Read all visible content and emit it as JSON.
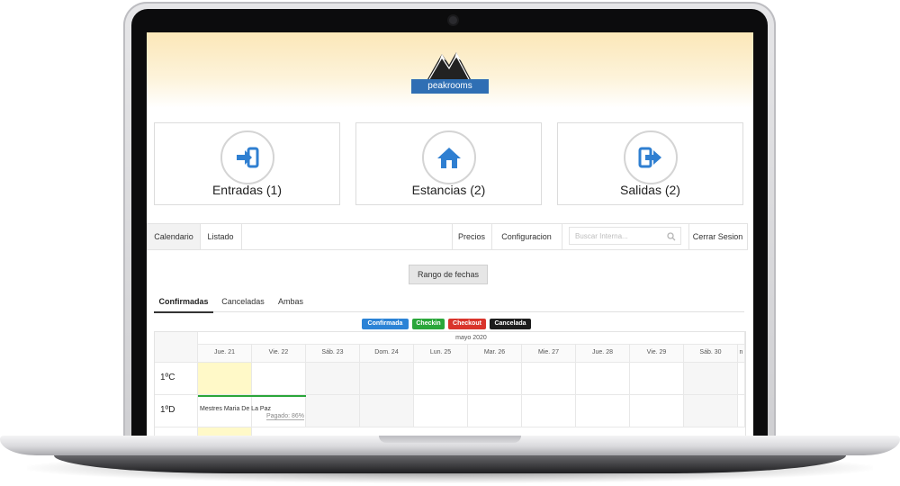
{
  "header": {
    "logo_text": "peakrooms"
  },
  "cards": [
    {
      "label": "Entradas (1)",
      "icon": "sign-in-icon"
    },
    {
      "label": "Estancias (2)",
      "icon": "home-icon"
    },
    {
      "label": "Salidas (2)",
      "icon": "sign-out-icon"
    }
  ],
  "nav": {
    "calendario": "Calendario",
    "listado": "Listado",
    "precios": "Precios",
    "configuracion": "Configuracion",
    "search_placeholder": "Buscar Interna...",
    "cerrar_sesion": "Cerrar Sesion"
  },
  "range_button": "Rango de fechas",
  "tabs": [
    "Confirmadas",
    "Canceladas",
    "Ambas"
  ],
  "legend": [
    {
      "label": "Confirmada",
      "color": "#2b83d6"
    },
    {
      "label": "Checkin",
      "color": "#2aa63a"
    },
    {
      "label": "Checkout",
      "color": "#d9342b"
    },
    {
      "label": "Cancelada",
      "color": "#1d1d1d"
    }
  ],
  "calendar": {
    "month": "mayo 2020",
    "days": [
      "Jue. 21",
      "Vie. 22",
      "Sáb. 23",
      "Dom. 24",
      "Lun. 25",
      "Mar. 26",
      "Mie. 27",
      "Jue. 28",
      "Vie. 29",
      "Sáb. 30",
      "n"
    ],
    "rooms": [
      "1ºC",
      "1ºD"
    ],
    "booking": {
      "guest": "Mestres Maria De La Paz",
      "paid": "Pagado: 86%"
    }
  },
  "colors": {
    "accent": "#2f6fb4",
    "icon_blue": "#2f7fd1",
    "highlight_day": "#fff9c8"
  }
}
